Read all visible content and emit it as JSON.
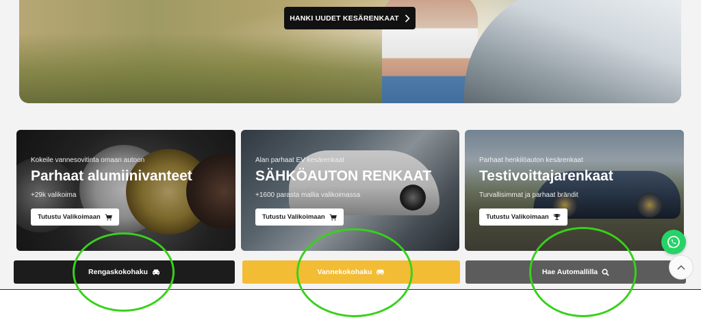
{
  "hero": {
    "button_label": "HANKI UUDET KESÄRENKAAT"
  },
  "cards": [
    {
      "sub": "Kokeile vannesovitinta omaan autoon",
      "title": "Parhaat alumiinivanteet",
      "desc": "+29k valikoima",
      "cta": "Tutustu Valikoimaan",
      "icon": "cart-icon"
    },
    {
      "sub": "Alan parhaat EV kesärenkaat",
      "title": "SÄHKÖAUTON RENKAAT",
      "desc": "+1600 parasta mallia valikoimassa",
      "cta": "Tutustu Valikoimaan",
      "icon": "cart-icon"
    },
    {
      "sub": "Parhaat henkilöauton kesärenkaat",
      "title": "Testivoittajarenkaat",
      "desc": "Turvallisimmat ja parhaat brändit",
      "cta": "Tutustu Valikoimaan",
      "icon": "trophy-icon"
    }
  ],
  "search_buttons": [
    {
      "label": "Rengaskokohaku",
      "icon": "car-icon",
      "color": "#1c1c1c"
    },
    {
      "label": "Vannekokohaku",
      "icon": "car-icon",
      "color": "#f3bc35"
    },
    {
      "label": "Hae Automallilla",
      "icon": "search-icon",
      "color": "#5c5c5c"
    }
  ],
  "colors": {
    "accent_yellow": "#f3bc35",
    "whatsapp_green": "#25d366",
    "annotation_green": "#38d11b"
  }
}
